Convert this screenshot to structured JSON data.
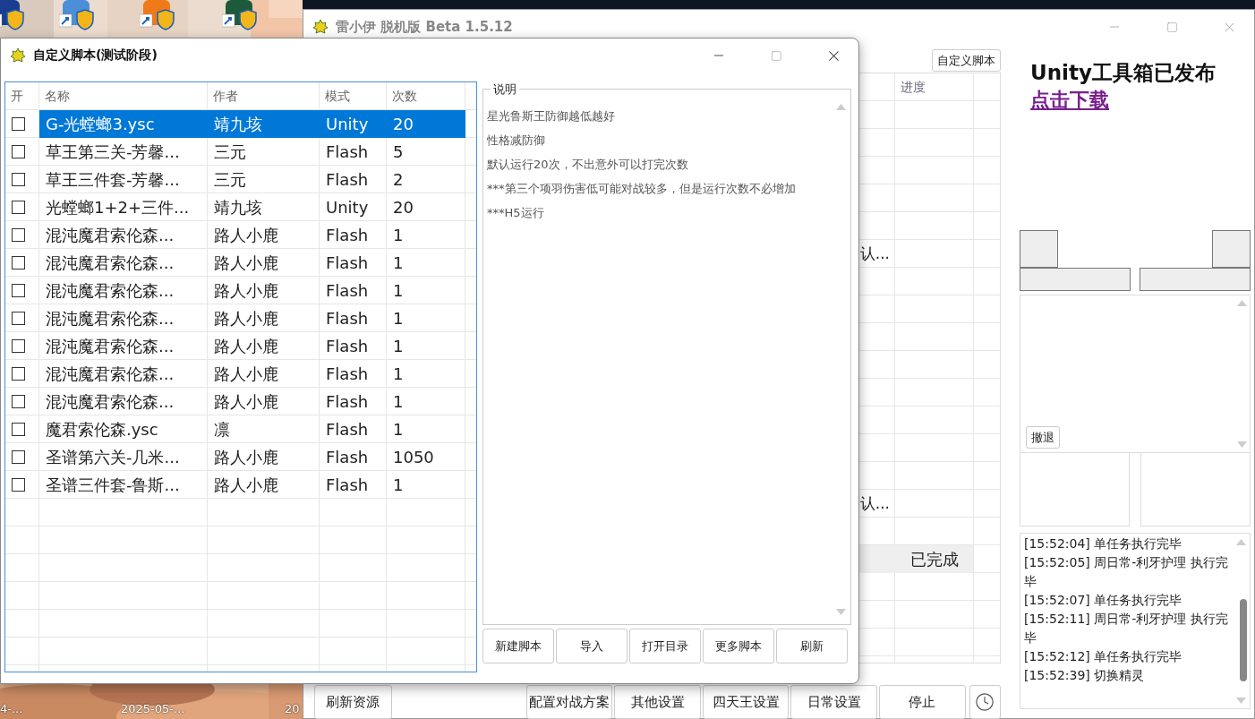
{
  "desktop": {
    "labels": [
      "4-...",
      "2025-05-...",
      "20"
    ]
  },
  "main_window": {
    "title": "雷小伊 脱机版 Beta 1.5.12",
    "custom_script_button": "自定义脚本",
    "table": {
      "columns": [
        "进度"
      ],
      "rows": [
        {
          "highlighted": false
        },
        {
          "highlighted": false
        },
        {
          "highlighted": false
        },
        {
          "highlighted": false
        },
        {
          "highlighted": false
        },
        {
          "column_1": "认...",
          "highlighted": false
        },
        {
          "highlighted": false
        },
        {
          "highlighted": false
        },
        {
          "highlighted": false
        },
        {
          "highlighted": false
        },
        {
          "highlighted": false
        },
        {
          "highlighted": false
        },
        {
          "highlighted": false
        },
        {
          "highlighted": false
        },
        {
          "column_1": "认...",
          "highlighted": false
        },
        {
          "highlighted": false
        },
        {
          "progress": "已完成",
          "highlighted": true
        },
        {
          "highlighted": false
        },
        {
          "highlighted": false
        },
        {
          "highlighted": false
        }
      ]
    },
    "left_button": "刷新资源",
    "buttons": [
      "配置对战方案",
      "其他设置",
      "四天王设置",
      "日常设置",
      "停止"
    ],
    "promo": {
      "headline": "Unity工具箱已发布",
      "link": "点击下载"
    },
    "retreat_button": "撤退",
    "log": [
      "[15:52:04] 单任务执行完毕",
      "[15:52:05] 周日常-利牙护理 执行完毕",
      "[15:52:07] 单任务执行完毕",
      "[15:52:11] 周日常-利牙护理 执行完毕",
      "[15:52:12] 单任务执行完毕",
      "[15:52:39] 切换精灵"
    ]
  },
  "dialog": {
    "title": "自定义脚本(测试阶段)",
    "columns": [
      "开",
      "名称",
      "作者",
      "模式",
      "次数"
    ],
    "rows": [
      {
        "enabled": false,
        "selected": true,
        "name": "G-光螳螂3.ysc",
        "author": "靖九垓",
        "mode": "Unity",
        "count": "20"
      },
      {
        "enabled": false,
        "selected": false,
        "name": "草王第三关-芳馨...",
        "author": "三元",
        "mode": "Flash",
        "count": "5"
      },
      {
        "enabled": false,
        "selected": false,
        "name": "草王三件套-芳馨...",
        "author": "三元",
        "mode": "Flash",
        "count": "2"
      },
      {
        "enabled": false,
        "selected": false,
        "name": "光螳螂1+2+三件...",
        "author": "靖九垓",
        "mode": "Unity",
        "count": "20"
      },
      {
        "enabled": false,
        "selected": false,
        "name": "混沌魔君索伦森...",
        "author": "路人小鹿",
        "mode": "Flash",
        "count": "1"
      },
      {
        "enabled": false,
        "selected": false,
        "name": "混沌魔君索伦森...",
        "author": "路人小鹿",
        "mode": "Flash",
        "count": "1"
      },
      {
        "enabled": false,
        "selected": false,
        "name": "混沌魔君索伦森...",
        "author": "路人小鹿",
        "mode": "Flash",
        "count": "1"
      },
      {
        "enabled": false,
        "selected": false,
        "name": "混沌魔君索伦森...",
        "author": "路人小鹿",
        "mode": "Flash",
        "count": "1"
      },
      {
        "enabled": false,
        "selected": false,
        "name": "混沌魔君索伦森...",
        "author": "路人小鹿",
        "mode": "Flash",
        "count": "1"
      },
      {
        "enabled": false,
        "selected": false,
        "name": "混沌魔君索伦森...",
        "author": "路人小鹿",
        "mode": "Flash",
        "count": "1"
      },
      {
        "enabled": false,
        "selected": false,
        "name": "混沌魔君索伦森...",
        "author": "路人小鹿",
        "mode": "Flash",
        "count": "1"
      },
      {
        "enabled": false,
        "selected": false,
        "name": "魔君索伦森.ysc",
        "author": "凛",
        "mode": "Flash",
        "count": "1"
      },
      {
        "enabled": false,
        "selected": false,
        "name": "圣谱第六关-几米...",
        "author": "路人小鹿",
        "mode": "Flash",
        "count": "1050"
      },
      {
        "enabled": false,
        "selected": false,
        "name": "圣谱三件套-鲁斯...",
        "author": "路人小鹿",
        "mode": "Flash",
        "count": "1"
      }
    ],
    "description": {
      "label": "说明",
      "lines": [
        "星光鲁斯王防御越低越好",
        "性格减防御",
        "默认运行20次，不出意外可以打完次数",
        "***第三个项羽伤害低可能对战较多，但是运行次数不必增加",
        "***H5运行"
      ]
    },
    "buttons": [
      "新建脚本",
      "导入",
      "打开目录",
      "更多脚本",
      "刷新"
    ]
  }
}
